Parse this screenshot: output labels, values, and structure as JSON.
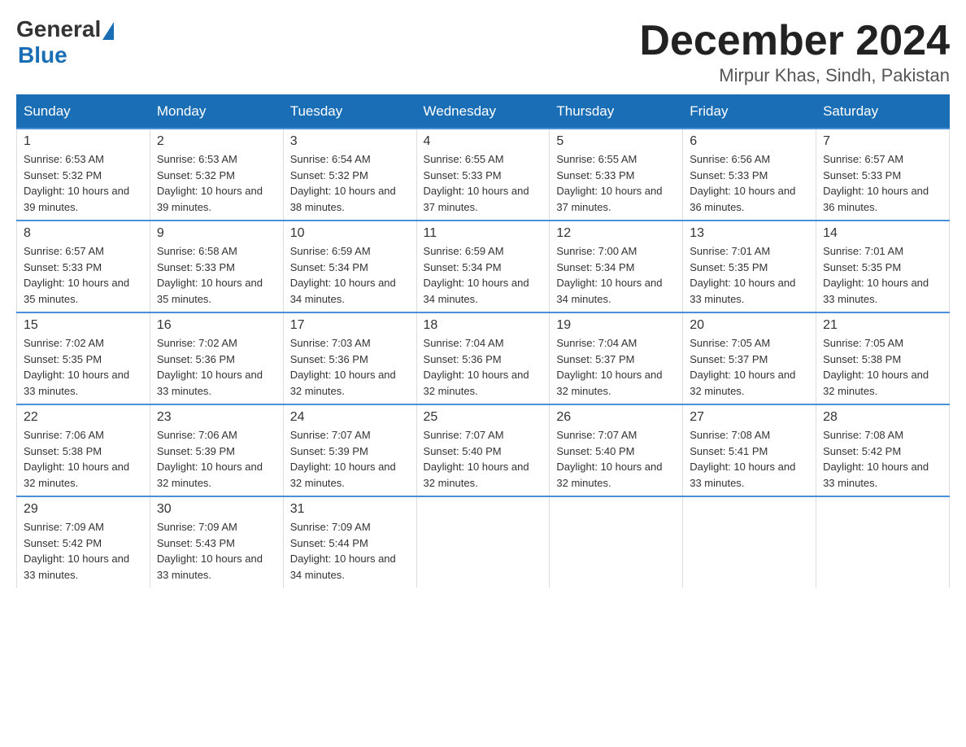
{
  "header": {
    "logo": {
      "general": "General",
      "blue": "Blue"
    },
    "title": "December 2024",
    "location": "Mirpur Khas, Sindh, Pakistan"
  },
  "days_of_week": [
    "Sunday",
    "Monday",
    "Tuesday",
    "Wednesday",
    "Thursday",
    "Friday",
    "Saturday"
  ],
  "weeks": [
    [
      {
        "day": "1",
        "sunrise": "Sunrise: 6:53 AM",
        "sunset": "Sunset: 5:32 PM",
        "daylight": "Daylight: 10 hours and 39 minutes."
      },
      {
        "day": "2",
        "sunrise": "Sunrise: 6:53 AM",
        "sunset": "Sunset: 5:32 PM",
        "daylight": "Daylight: 10 hours and 39 minutes."
      },
      {
        "day": "3",
        "sunrise": "Sunrise: 6:54 AM",
        "sunset": "Sunset: 5:32 PM",
        "daylight": "Daylight: 10 hours and 38 minutes."
      },
      {
        "day": "4",
        "sunrise": "Sunrise: 6:55 AM",
        "sunset": "Sunset: 5:33 PM",
        "daylight": "Daylight: 10 hours and 37 minutes."
      },
      {
        "day": "5",
        "sunrise": "Sunrise: 6:55 AM",
        "sunset": "Sunset: 5:33 PM",
        "daylight": "Daylight: 10 hours and 37 minutes."
      },
      {
        "day": "6",
        "sunrise": "Sunrise: 6:56 AM",
        "sunset": "Sunset: 5:33 PM",
        "daylight": "Daylight: 10 hours and 36 minutes."
      },
      {
        "day": "7",
        "sunrise": "Sunrise: 6:57 AM",
        "sunset": "Sunset: 5:33 PM",
        "daylight": "Daylight: 10 hours and 36 minutes."
      }
    ],
    [
      {
        "day": "8",
        "sunrise": "Sunrise: 6:57 AM",
        "sunset": "Sunset: 5:33 PM",
        "daylight": "Daylight: 10 hours and 35 minutes."
      },
      {
        "day": "9",
        "sunrise": "Sunrise: 6:58 AM",
        "sunset": "Sunset: 5:33 PM",
        "daylight": "Daylight: 10 hours and 35 minutes."
      },
      {
        "day": "10",
        "sunrise": "Sunrise: 6:59 AM",
        "sunset": "Sunset: 5:34 PM",
        "daylight": "Daylight: 10 hours and 34 minutes."
      },
      {
        "day": "11",
        "sunrise": "Sunrise: 6:59 AM",
        "sunset": "Sunset: 5:34 PM",
        "daylight": "Daylight: 10 hours and 34 minutes."
      },
      {
        "day": "12",
        "sunrise": "Sunrise: 7:00 AM",
        "sunset": "Sunset: 5:34 PM",
        "daylight": "Daylight: 10 hours and 34 minutes."
      },
      {
        "day": "13",
        "sunrise": "Sunrise: 7:01 AM",
        "sunset": "Sunset: 5:35 PM",
        "daylight": "Daylight: 10 hours and 33 minutes."
      },
      {
        "day": "14",
        "sunrise": "Sunrise: 7:01 AM",
        "sunset": "Sunset: 5:35 PM",
        "daylight": "Daylight: 10 hours and 33 minutes."
      }
    ],
    [
      {
        "day": "15",
        "sunrise": "Sunrise: 7:02 AM",
        "sunset": "Sunset: 5:35 PM",
        "daylight": "Daylight: 10 hours and 33 minutes."
      },
      {
        "day": "16",
        "sunrise": "Sunrise: 7:02 AM",
        "sunset": "Sunset: 5:36 PM",
        "daylight": "Daylight: 10 hours and 33 minutes."
      },
      {
        "day": "17",
        "sunrise": "Sunrise: 7:03 AM",
        "sunset": "Sunset: 5:36 PM",
        "daylight": "Daylight: 10 hours and 32 minutes."
      },
      {
        "day": "18",
        "sunrise": "Sunrise: 7:04 AM",
        "sunset": "Sunset: 5:36 PM",
        "daylight": "Daylight: 10 hours and 32 minutes."
      },
      {
        "day": "19",
        "sunrise": "Sunrise: 7:04 AM",
        "sunset": "Sunset: 5:37 PM",
        "daylight": "Daylight: 10 hours and 32 minutes."
      },
      {
        "day": "20",
        "sunrise": "Sunrise: 7:05 AM",
        "sunset": "Sunset: 5:37 PM",
        "daylight": "Daylight: 10 hours and 32 minutes."
      },
      {
        "day": "21",
        "sunrise": "Sunrise: 7:05 AM",
        "sunset": "Sunset: 5:38 PM",
        "daylight": "Daylight: 10 hours and 32 minutes."
      }
    ],
    [
      {
        "day": "22",
        "sunrise": "Sunrise: 7:06 AM",
        "sunset": "Sunset: 5:38 PM",
        "daylight": "Daylight: 10 hours and 32 minutes."
      },
      {
        "day": "23",
        "sunrise": "Sunrise: 7:06 AM",
        "sunset": "Sunset: 5:39 PM",
        "daylight": "Daylight: 10 hours and 32 minutes."
      },
      {
        "day": "24",
        "sunrise": "Sunrise: 7:07 AM",
        "sunset": "Sunset: 5:39 PM",
        "daylight": "Daylight: 10 hours and 32 minutes."
      },
      {
        "day": "25",
        "sunrise": "Sunrise: 7:07 AM",
        "sunset": "Sunset: 5:40 PM",
        "daylight": "Daylight: 10 hours and 32 minutes."
      },
      {
        "day": "26",
        "sunrise": "Sunrise: 7:07 AM",
        "sunset": "Sunset: 5:40 PM",
        "daylight": "Daylight: 10 hours and 32 minutes."
      },
      {
        "day": "27",
        "sunrise": "Sunrise: 7:08 AM",
        "sunset": "Sunset: 5:41 PM",
        "daylight": "Daylight: 10 hours and 33 minutes."
      },
      {
        "day": "28",
        "sunrise": "Sunrise: 7:08 AM",
        "sunset": "Sunset: 5:42 PM",
        "daylight": "Daylight: 10 hours and 33 minutes."
      }
    ],
    [
      {
        "day": "29",
        "sunrise": "Sunrise: 7:09 AM",
        "sunset": "Sunset: 5:42 PM",
        "daylight": "Daylight: 10 hours and 33 minutes."
      },
      {
        "day": "30",
        "sunrise": "Sunrise: 7:09 AM",
        "sunset": "Sunset: 5:43 PM",
        "daylight": "Daylight: 10 hours and 33 minutes."
      },
      {
        "day": "31",
        "sunrise": "Sunrise: 7:09 AM",
        "sunset": "Sunset: 5:44 PM",
        "daylight": "Daylight: 10 hours and 34 minutes."
      },
      null,
      null,
      null,
      null
    ]
  ]
}
